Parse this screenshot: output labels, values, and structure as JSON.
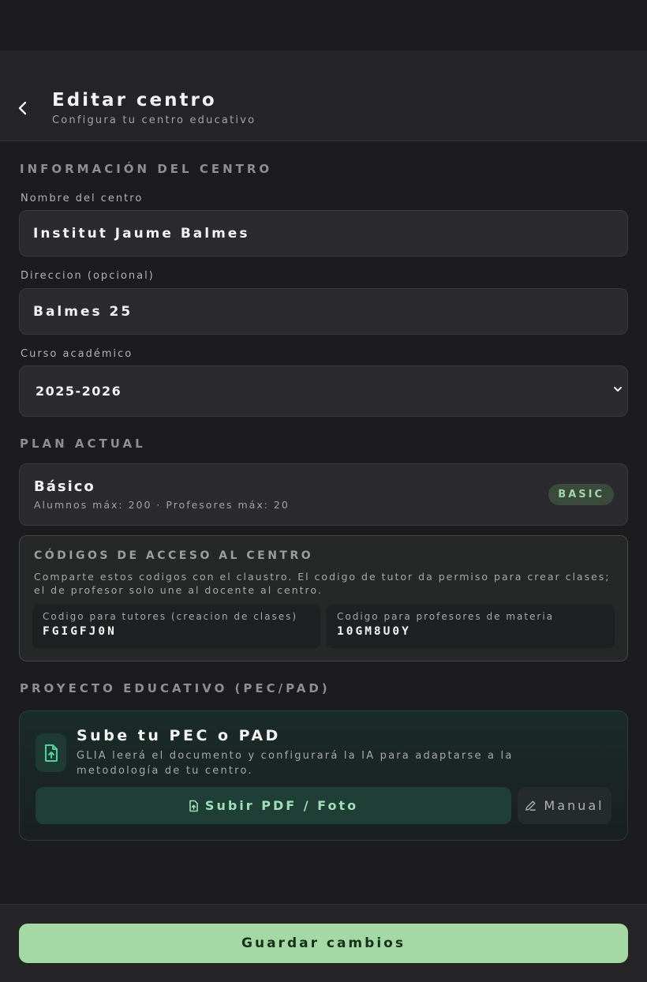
{
  "header": {
    "title": "Editar centro",
    "subtitle": "Configura tu centro educativo"
  },
  "info": {
    "section_title": "INFORMACIÓN DEL CENTRO",
    "name_label": "Nombre del centro",
    "name_value": "Institut Jaume Balmes",
    "address_label": "Direccion (opcional)",
    "address_value": "Balmes 25",
    "course_label": "Curso académico",
    "course_value": "2025-2026"
  },
  "plan": {
    "section_title": "PLAN ACTUAL",
    "name": "Básico",
    "limits": "Alumnos máx: 200 · Profesores máx: 20",
    "badge": "BASIC"
  },
  "codes": {
    "title": "CÓDIGOS DE ACCESO AL CENTRO",
    "description": "Comparte estos codigos con el claustro. El codigo de tutor da permiso para crear clases; el de profesor solo une al docente al centro.",
    "tutor_label": "Codigo para tutores (creacion de clases)",
    "tutor_code": "FGIGFJ0N",
    "teacher_label": "Codigo para profesores de materia",
    "teacher_code": "10GM8U0Y"
  },
  "pec": {
    "section_title": "PROYECTO EDUCATIVO (PEC/PAD)",
    "title": "Sube tu PEC o PAD",
    "description": "GLIA leerá el documento y configurará la IA para adaptarse a la metodología de tu centro.",
    "upload_label": "Subir PDF / Foto",
    "manual_label": "Manual",
    "icon": "file-upload-icon"
  },
  "footer": {
    "save_label": "Guardar cambios"
  },
  "colors": {
    "accent": "#a4d9a6",
    "badge_text": "#9fd8a6",
    "upload_text": "#9fe0b7"
  }
}
